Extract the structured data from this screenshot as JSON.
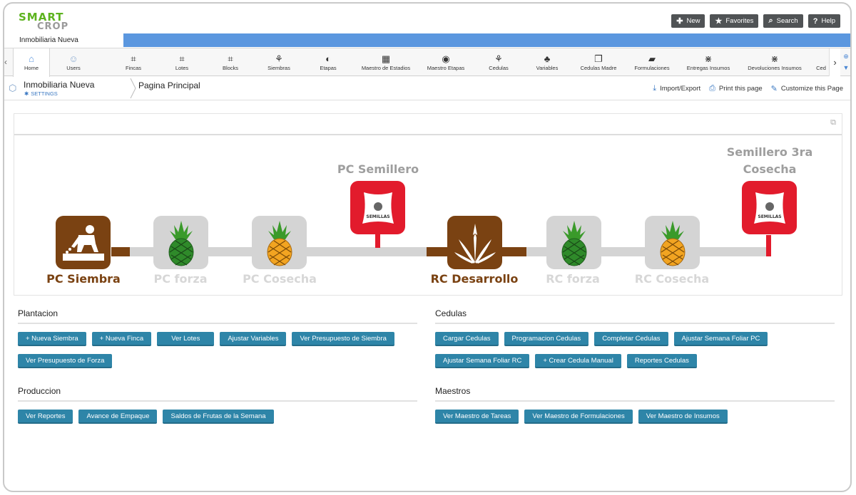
{
  "brand": {
    "line1": "SMART",
    "line2": "CROP"
  },
  "header": {
    "company": "Inmobiliaria Nueva",
    "buttons": [
      {
        "label": "New",
        "icon": "plus-icon"
      },
      {
        "label": "Favorites",
        "icon": "star-icon"
      },
      {
        "label": "Search",
        "icon": "search-icon"
      },
      {
        "label": "Help",
        "icon": "help-icon"
      }
    ]
  },
  "toolbar": {
    "items": [
      {
        "label": "Home",
        "icon": "home-icon"
      },
      {
        "label": "Users",
        "icon": "user-icon"
      },
      {
        "label": "Fincas",
        "icon": "grid-icon"
      },
      {
        "label": "Lotes",
        "icon": "grid-icon"
      },
      {
        "label": "Blocks",
        "icon": "grid-icon"
      },
      {
        "label": "Siembras",
        "icon": "sprout-icon"
      },
      {
        "label": "Etapas",
        "icon": "gauge-icon"
      },
      {
        "label": "Maestro de Estadios",
        "icon": "table-gear-icon"
      },
      {
        "label": "Maestro Etapas",
        "icon": "gauge-icon"
      },
      {
        "label": "Cedulas",
        "icon": "sprout-icon"
      },
      {
        "label": "Variables",
        "icon": "tree-icon"
      },
      {
        "label": "Cedulas Madre",
        "icon": "documents-icon"
      },
      {
        "label": "Formulaciones",
        "icon": "laptop-icon"
      },
      {
        "label": "Entregas Insumos",
        "icon": "flow-icon"
      },
      {
        "label": "Devoluciones Insumos",
        "icon": "flow-icon"
      },
      {
        "label": "Ced",
        "icon": ""
      }
    ]
  },
  "breadcrumb": {
    "company": "Inmobiliaria Nueva",
    "settings": "SETTINGS",
    "page": "Pagina Principal",
    "actions": [
      {
        "label": "Import/Export",
        "icon": "import-icon"
      },
      {
        "label": "Print this page",
        "icon": "print-icon"
      },
      {
        "label": "Customize this Page",
        "icon": "wrench-icon"
      }
    ]
  },
  "diagram": {
    "stages": [
      {
        "label": "PC Siembra",
        "kind": "planting",
        "state": "active"
      },
      {
        "label": "PC forza",
        "kind": "pineapple-green",
        "state": "inactive"
      },
      {
        "label": "PC Cosecha",
        "kind": "pineapple-ripe",
        "state": "inactive"
      },
      {
        "label": "PC Semillero",
        "kind": "seed-sack",
        "state": "branch"
      },
      {
        "label": "RC Desarrollo",
        "kind": "plant",
        "state": "active"
      },
      {
        "label": "RC forza",
        "kind": "pineapple-green",
        "state": "inactive"
      },
      {
        "label": "RC Cosecha",
        "kind": "pineapple-ripe",
        "state": "inactive"
      },
      {
        "label": "Semillero 3ra",
        "label2": "Cosecha",
        "kind": "seed-sack",
        "state": "branch"
      }
    ],
    "sack_text": "SEMILLAS",
    "colors": {
      "active": "#7a4212",
      "inactive": "#d4d4d4",
      "branch": "#e21b2c"
    }
  },
  "sections": {
    "plantacion": {
      "title": "Plantacion",
      "buttons": [
        "+ Nueva Siembra",
        "+ Nueva Finca",
        "Ver Lotes",
        "Ajustar Variables",
        "Ver Presupuesto de Siembra",
        "Ver Presupuesto de Forza"
      ]
    },
    "cedulas": {
      "title": "Cedulas",
      "buttons": [
        "Cargar Cedulas",
        "Programacion Cedulas",
        "Completar Cedulas",
        "Ajustar Semana Foliar PC",
        "Ajustar Semana Foliar RC",
        "+ Crear Cedula Manual",
        "Reportes Cedulas"
      ]
    },
    "produccion": {
      "title": "Produccion",
      "buttons": [
        "Ver Reportes",
        "Avance de Empaque",
        "Saldos de Frutas de la Semana"
      ]
    },
    "maestros": {
      "title": "Maestros",
      "buttons": [
        "Ver Maestro de Tareas",
        "Ver Maestro de Formulaciones",
        "Ver Maestro de Insumos"
      ]
    }
  },
  "accent_color": "#2e85a8"
}
